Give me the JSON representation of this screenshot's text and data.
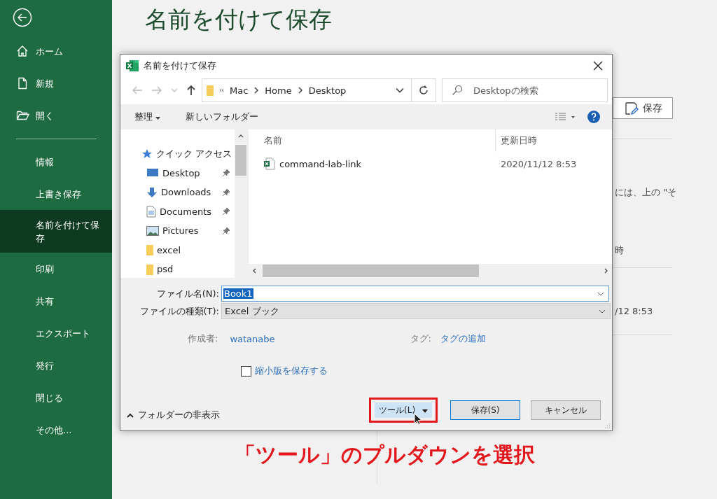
{
  "sidebar": {
    "items": [
      {
        "label": "ホーム",
        "kind": "home",
        "selected": false
      },
      {
        "label": "新規",
        "kind": "new",
        "selected": false
      },
      {
        "label": "開く",
        "kind": "open",
        "selected": false
      },
      {
        "label": "情報",
        "kind": "text",
        "selected": false
      },
      {
        "label": "上書き保存",
        "kind": "text",
        "selected": false
      },
      {
        "label": "名前を付けて保存",
        "kind": "text",
        "selected": true
      },
      {
        "label": "印刷",
        "kind": "text",
        "selected": false
      },
      {
        "label": "共有",
        "kind": "text",
        "selected": false
      },
      {
        "label": "エクスポート",
        "kind": "text",
        "selected": false
      },
      {
        "label": "発行",
        "kind": "text",
        "selected": false
      },
      {
        "label": "閉じる",
        "kind": "text",
        "selected": false
      },
      {
        "label": "その他...",
        "kind": "text",
        "selected": false
      }
    ]
  },
  "page_title": "名前を付けて保存",
  "background": {
    "save_button": "保存",
    "texts": [
      "には、上の \"そ",
      "時",
      "/12 8:53"
    ]
  },
  "dialog": {
    "title": "名前を付けて保存",
    "address": [
      "Mac",
      "Home",
      "Desktop"
    ],
    "search": {
      "placeholder": "Desktopの検索"
    },
    "toolbar": {
      "organize": "整理",
      "new_folder": "新しいフォルダー"
    },
    "nav_items": [
      {
        "label": "クイック アクセス",
        "kind": "star",
        "pinned": false
      },
      {
        "label": "Desktop",
        "kind": "desktop",
        "pinned": true
      },
      {
        "label": "Downloads",
        "kind": "download",
        "pinned": true
      },
      {
        "label": "Documents",
        "kind": "document",
        "pinned": true
      },
      {
        "label": "Pictures",
        "kind": "pictures",
        "pinned": true
      },
      {
        "label": "excel",
        "kind": "folder",
        "pinned": false
      },
      {
        "label": "psd",
        "kind": "folder",
        "pinned": false
      }
    ],
    "columns": [
      "名前",
      "更新日時"
    ],
    "files": [
      {
        "name": "command-lab-link",
        "modified": "2020/11/12 8:53"
      }
    ],
    "file_name": {
      "label": "ファイル名(N):",
      "value": "Book1",
      "value_selected": true
    },
    "file_type": {
      "label": "ファイルの種類(T):",
      "value": "Excel ブック"
    },
    "author": {
      "label": "作成者:",
      "value": "watanabe"
    },
    "tags": {
      "label": "タグ:",
      "value": "タグの追加"
    },
    "thumbnail": {
      "label": "縮小版を保存する",
      "checked": false
    },
    "hide_folders": "フォルダーの非表示",
    "buttons": {
      "tools": "ツール(L)",
      "save": "保存(S)",
      "cancel": "キャンセル"
    }
  },
  "annotation": {
    "text": "「ツール」のプルダウンを選択",
    "highlight_tools": true
  }
}
